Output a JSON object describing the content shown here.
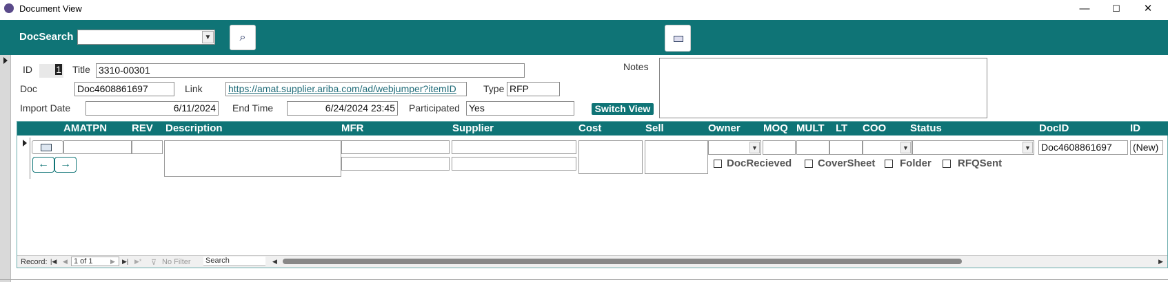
{
  "window": {
    "title": "Document View",
    "minimize": "—",
    "maximize": "☐",
    "close": "✕"
  },
  "toolbar": {
    "docsearch_label": "DocSearch",
    "docsearch_value": "",
    "search_icon": "⌕"
  },
  "form": {
    "id_label": "ID",
    "id_value": "1",
    "title_label": "Title",
    "title_value": "3310-00301",
    "doc_label": "Doc",
    "doc_value": "Doc4608861697",
    "link_label": "Link",
    "link_value": "https://amat.supplier.ariba.com/ad/webjumper?itemID",
    "type_label": "Type",
    "type_value": "RFP",
    "import_date_label": "Import Date",
    "import_date_value": "6/11/2024",
    "end_time_label": "End Time",
    "end_time_value": "6/24/2024 23:45",
    "participated_label": "Participated",
    "participated_value": "Yes",
    "notes_label": "Notes",
    "notes_value": "",
    "switch_view_label": "Switch View"
  },
  "subform": {
    "headers": {
      "amatpn": "AMATPN",
      "rev": "REV",
      "description": "Description",
      "mfr": "MFR",
      "supplier": "Supplier",
      "cost": "Cost",
      "sell": "Sell",
      "owner": "Owner",
      "moq": "MOQ",
      "mult": "MULT",
      "lt": "LT",
      "coo": "COO",
      "status": "Status",
      "docid": "DocID",
      "id": "ID"
    },
    "row": {
      "docid_value": "Doc4608861697",
      "id_value": "(New)"
    },
    "checkboxes": {
      "doc_recieved": "DocRecieved",
      "cover_sheet": "CoverSheet",
      "folder": "Folder",
      "rfq_sent": "RFQSent"
    },
    "nav": {
      "prev_icon": "←",
      "next_icon": "→"
    }
  },
  "record_nav": {
    "record_label": "Record:",
    "position": "1 of 1",
    "filter_label": "No Filter",
    "search_placeholder": "Search"
  },
  "colors": {
    "teal": "#0f7476"
  }
}
